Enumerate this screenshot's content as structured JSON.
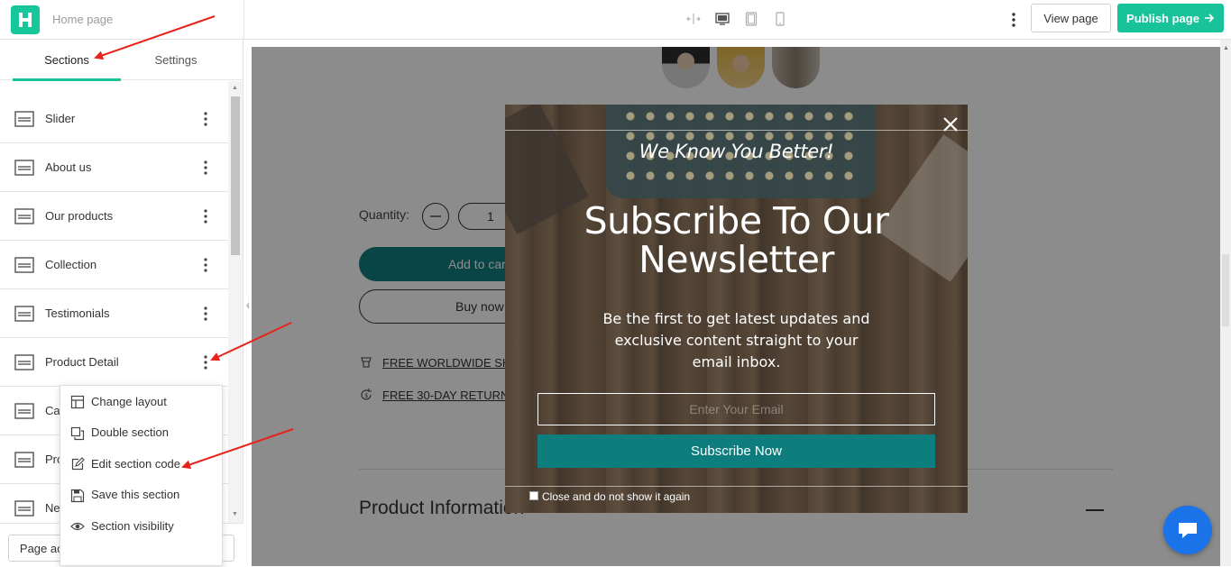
{
  "app": {
    "page_name": "Home page",
    "view_page_label": "View page",
    "publish_label": "Publish page",
    "device_icons": [
      "resize-icon",
      "desktop-icon",
      "tablet-icon",
      "mobile-icon"
    ]
  },
  "left_panel": {
    "tabs": [
      {
        "label": "Sections",
        "active": true
      },
      {
        "label": "Settings",
        "active": false
      }
    ],
    "sections": [
      {
        "label": "Slider"
      },
      {
        "label": "About us"
      },
      {
        "label": "Our products"
      },
      {
        "label": "Collection"
      },
      {
        "label": "Testimonials"
      },
      {
        "label": "Product Detail"
      },
      {
        "label": "Cal"
      },
      {
        "label": "Pro"
      },
      {
        "label": "Ne"
      }
    ],
    "context_menu": [
      {
        "label": "Change layout",
        "icon": "layout-icon"
      },
      {
        "label": "Double section",
        "icon": "duplicate-icon"
      },
      {
        "label": "Edit section code",
        "icon": "edit-icon"
      },
      {
        "label": "Save this section",
        "icon": "save-icon"
      },
      {
        "label": "Section visibility",
        "icon": "eye-icon"
      }
    ],
    "page_actions_label": "Page actions"
  },
  "canvas": {
    "quantity_label": "Quantity:",
    "quantity_value": "1",
    "add_to_cart_label": "Add to car",
    "buy_now_label": "Buy now",
    "shipping_line": "FREE WORLDWIDE SH",
    "returns_line": "FREE 30-DAY RETURN",
    "product_info_label": "Product Information"
  },
  "popup": {
    "tagline": "We Know You Better!",
    "title": "Subscribe To Our Newsletter",
    "description": "Be the first to get latest updates and exclusive content straight to your email inbox.",
    "email_placeholder": "Enter Your Email",
    "subscribe_label": "Subscribe Now",
    "dismiss_label": "Close and do not show it again"
  },
  "colors": {
    "brand_green": "#18c39a",
    "teal": "#117e80",
    "annotation_red": "#e8231c",
    "chat_blue": "#1a73e8"
  }
}
